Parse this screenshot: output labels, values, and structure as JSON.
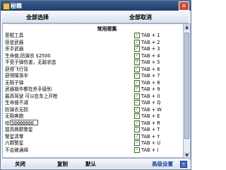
{
  "window": {
    "title": "秘籍",
    "close_glyph": "✕"
  },
  "top": {
    "select_all": "全部选择",
    "cancel_all": "全部取消"
  },
  "group": {
    "header": "常用密集"
  },
  "items": [
    {
      "label": "恶棍工具",
      "hotkey": "TAB + 1",
      "checked": true
    },
    {
      "label": "匪徒武器",
      "hotkey": "TAB + 2",
      "checked": true
    },
    {
      "label": "杀手武器",
      "hotkey": "TAB + 3",
      "checked": true
    },
    {
      "label": "生命值,防弹衣 $2500",
      "hotkey": "TAB + 4",
      "checked": true
    },
    {
      "label": "不受子弹伤害，无敌状态",
      "hotkey": "TAB + 5",
      "checked": true
    },
    {
      "label": "获得飞行背",
      "hotkey": "TAB + 6",
      "checked": true
    },
    {
      "label": "获得降落伞",
      "hotkey": "TAB + 7",
      "checked": true
    },
    {
      "label": "无限子弹",
      "hotkey": "TAB + 8",
      "checked": true
    },
    {
      "label": "武器操作都在杀手级别",
      "hotkey": "TAB + 9",
      "checked": true
    },
    {
      "label": "最高驾驶 可以在车上开枪",
      "hotkey": "TAB + 0",
      "checked": true
    },
    {
      "label": "生命值不减",
      "hotkey": "TAB + Q",
      "checked": true
    },
    {
      "label": "防弹衣无损",
      "hotkey": "TAB + W",
      "checked": true
    },
    {
      "label": "无限奔跑",
      "hotkey": "TAB + E",
      "checked": true
    },
    {
      "label": "给 $",
      "hotkey": "TAB + R",
      "checked": true,
      "input_value": "50000000"
    },
    {
      "label": "提高两颗警星",
      "hotkey": "TAB + T",
      "checked": true
    },
    {
      "label": "警星清零",
      "hotkey": "TAB + Y",
      "checked": true
    },
    {
      "label": "六颗警星",
      "hotkey": "TAB + U",
      "checked": true
    },
    {
      "label": "不会被通缉",
      "hotkey": "TAB + I",
      "checked": true
    }
  ],
  "scroll": {
    "up_glyph": "▲",
    "down_glyph": "▼"
  },
  "bottom": {
    "close": "关闭",
    "copy": "复制",
    "default": "默认",
    "advanced": "高级设置",
    "advanced_glyph": "»"
  },
  "colors": {
    "titlebar": "#1f3d6b",
    "check": "#1e7a1e",
    "advanced_link": "#1a3f9c"
  }
}
